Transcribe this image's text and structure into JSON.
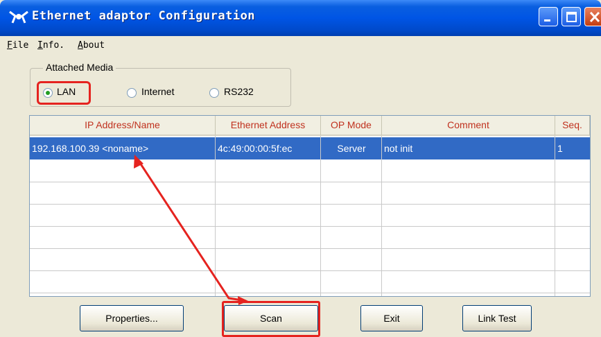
{
  "window": {
    "title": "Ethernet adaptor Configuration",
    "controls": [
      "minimize-icon",
      "maximize-icon",
      "close-icon"
    ]
  },
  "menu": {
    "items": [
      {
        "label": "File",
        "mnemonic": "F",
        "rest": "ile"
      },
      {
        "label": "Info.",
        "mnemonic": "I",
        "rest": "nfo."
      },
      {
        "label": "About",
        "mnemonic": "A",
        "rest": "bout"
      }
    ]
  },
  "media": {
    "group_label": "Attached Media",
    "options": [
      {
        "label": "LAN",
        "checked": true
      },
      {
        "label": "Internet",
        "checked": false
      },
      {
        "label": "RS232",
        "checked": false
      }
    ]
  },
  "table": {
    "columns": [
      "IP Address/Name",
      "Ethernet Address",
      "OP Mode",
      "Comment",
      "Seq."
    ],
    "rows": [
      {
        "ip": "192.168.100.39 <noname>",
        "mac": "4c:49:00:00:5f:ec",
        "mode": "Server",
        "comment": "not init",
        "seq": "1"
      }
    ]
  },
  "buttons": {
    "properties": "Properties...",
    "scan": "Scan",
    "exit": "Exit",
    "link_test": "Link Test"
  },
  "colors": {
    "highlight": "#e5231f",
    "selection": "#316ac5",
    "header_text": "#c0311e"
  }
}
